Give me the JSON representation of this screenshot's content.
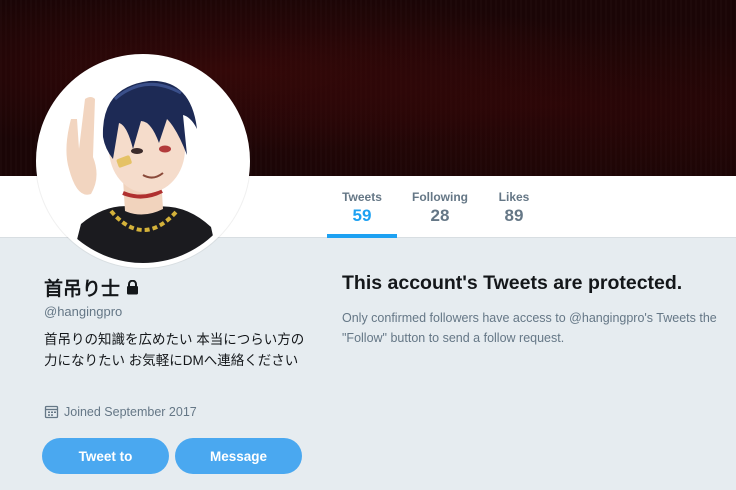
{
  "profile": {
    "display_name": "首吊り士",
    "handle": "@hangingpro",
    "bio": "首吊りの知識を広めたい 本当につらい方の力になりたい お気軽にDMへ連絡ください",
    "joined": "Joined September 2017"
  },
  "stats": {
    "tweets_label": "Tweets",
    "tweets_value": "59",
    "following_label": "Following",
    "following_value": "28",
    "likes_label": "Likes",
    "likes_value": "89"
  },
  "actions": {
    "tweet_to_label": "Tweet to",
    "message_label": "Message"
  },
  "protected": {
    "title": "This account's Tweets are protected.",
    "text": "Only confirmed followers have access to @hangingpro's Tweets the \"Follow\" button to send a follow request."
  },
  "colors": {
    "accent": "#1da1f2",
    "button": "#4aa8f0",
    "background": "#e6ecf0",
    "banner": "#1a0506"
  }
}
